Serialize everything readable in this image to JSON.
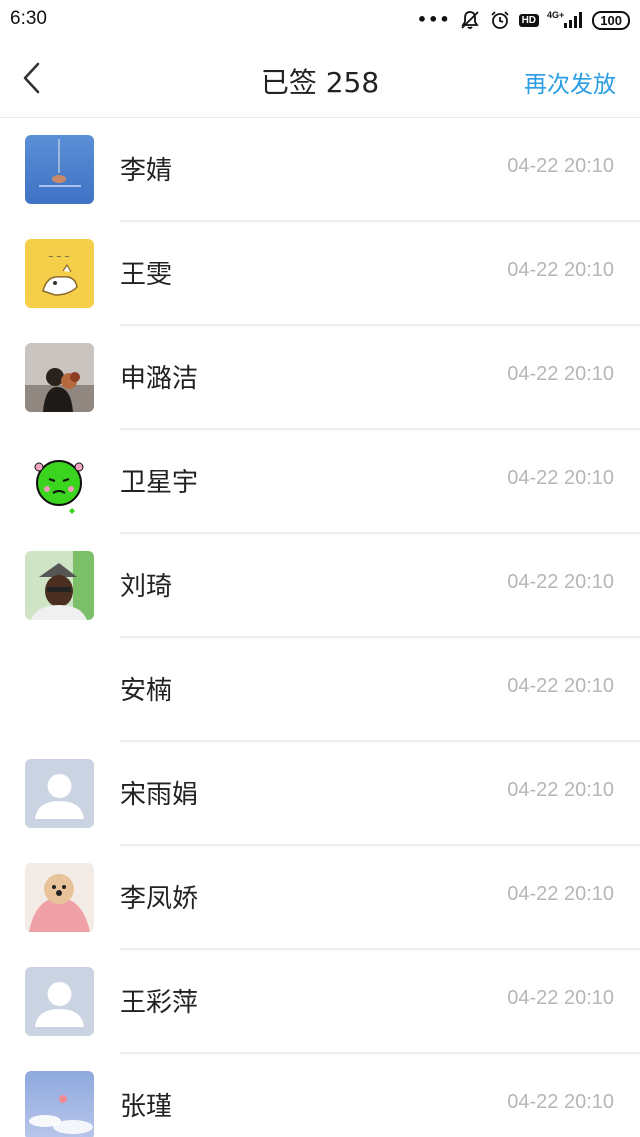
{
  "status": {
    "time": "6:30",
    "dots": "•••",
    "network": "4G+",
    "battery": "100",
    "hd": "HD",
    "icons": [
      "bell-off-icon",
      "alarm-icon",
      "hd-icon",
      "signal-icon",
      "battery-icon"
    ]
  },
  "header": {
    "title": "已签 258",
    "action": "再次发放",
    "accent": "#2b9de4"
  },
  "signees": [
    {
      "name": "李婧",
      "time": "04-22 20:10",
      "avatar": "blue-scene"
    },
    {
      "name": "王雯",
      "time": "04-22 20:10",
      "avatar": "yellow-cartoon"
    },
    {
      "name": "申潞洁",
      "time": "04-22 20:10",
      "avatar": "photo-bouquet"
    },
    {
      "name": "卫星宇",
      "time": "04-22 20:10",
      "avatar": "green-face"
    },
    {
      "name": "刘琦",
      "time": "04-22 20:10",
      "avatar": "photo-man"
    },
    {
      "name": "安楠",
      "time": "04-22 20:10",
      "avatar": "blank"
    },
    {
      "name": "宋雨娟",
      "time": "04-22 20:10",
      "avatar": "default-user"
    },
    {
      "name": "李凤娇",
      "time": "04-22 20:10",
      "avatar": "dog-photo"
    },
    {
      "name": "王彩萍",
      "time": "04-22 20:10",
      "avatar": "default-user"
    },
    {
      "name": "张瑾",
      "time": "04-22 20:10",
      "avatar": "sky-photo"
    }
  ]
}
